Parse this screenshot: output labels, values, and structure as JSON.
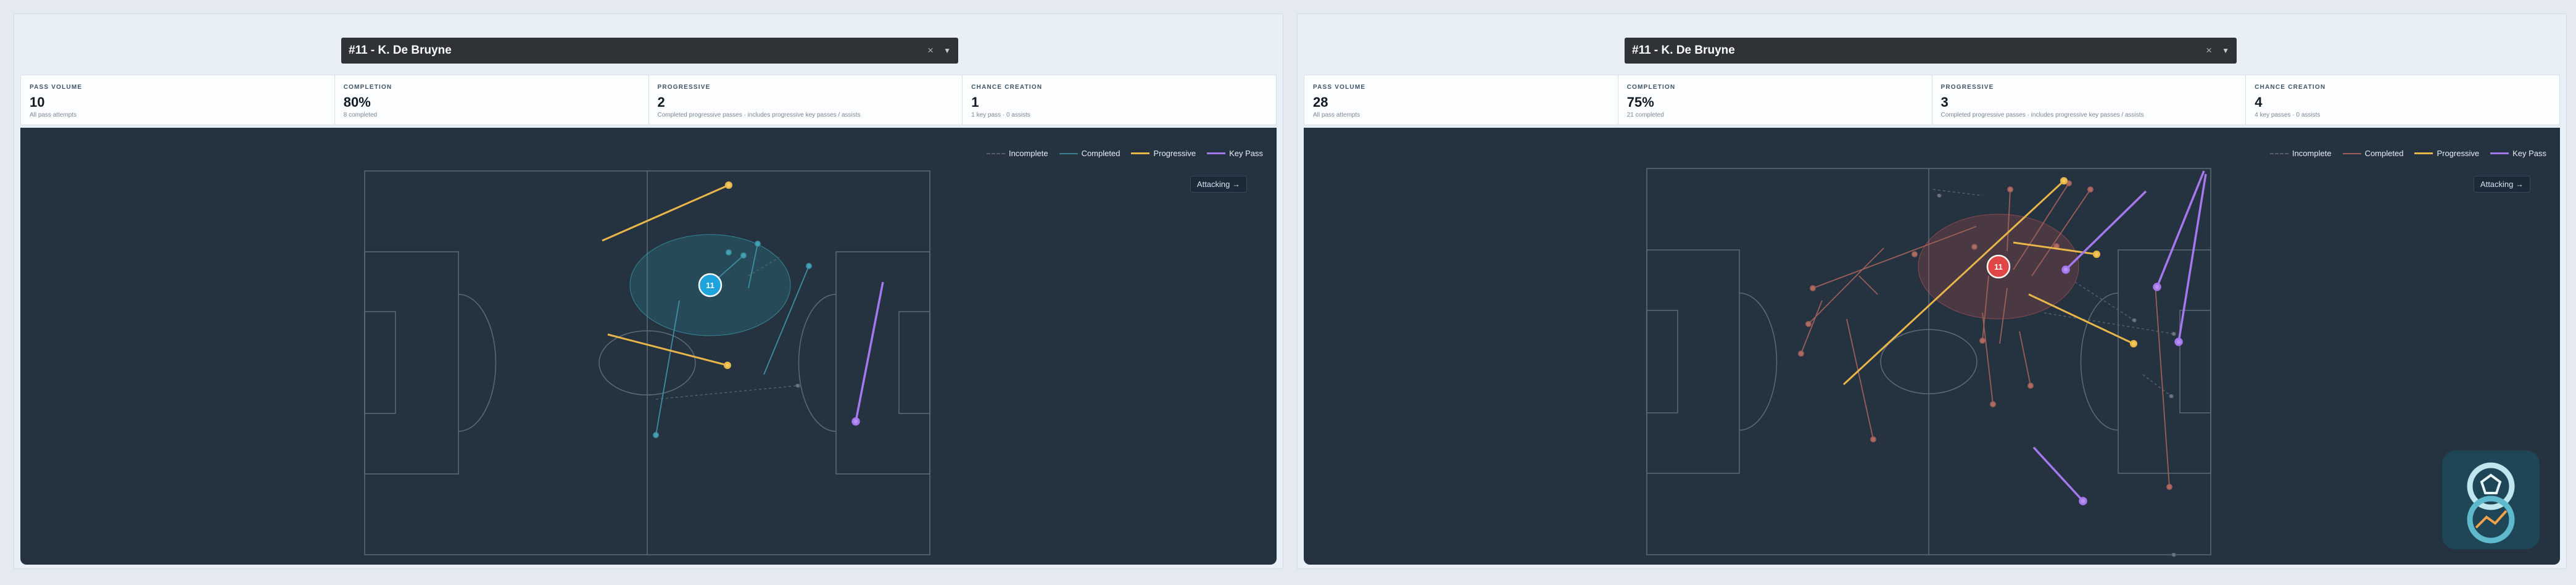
{
  "panels": [
    {
      "player_select": "#11 - K. De Bruyne",
      "clear_glyph": "×",
      "caret_glyph": "▼",
      "stats": [
        {
          "label": "PASS VOLUME",
          "value": "10",
          "sub": "All pass attempts"
        },
        {
          "label": "COMPLETION",
          "value": "80%",
          "sub": "8 completed"
        },
        {
          "label": "PROGRESSIVE",
          "value": "2",
          "sub": "Completed progressive passes · includes progressive key passes / assists"
        },
        {
          "label": "CHANCE CREATION",
          "value": "1",
          "sub": "1 key pass · 0 assists"
        }
      ],
      "legend": {
        "incomplete": "Incomplete",
        "completed": "Completed",
        "progressive": "Progressive",
        "key_pass": "Key Pass"
      },
      "direction_button": "Attacking →",
      "player_marker": "11",
      "accent_color": "#1fa3dc"
    },
    {
      "player_select": "#11 - K. De Bruyne",
      "clear_glyph": "×",
      "caret_glyph": "▼",
      "stats": [
        {
          "label": "PASS VOLUME",
          "value": "28",
          "sub": "All pass attempts"
        },
        {
          "label": "COMPLETION",
          "value": "75%",
          "sub": "21 completed"
        },
        {
          "label": "PROGRESSIVE",
          "value": "3",
          "sub": "Completed progressive passes · includes progressive key passes / assists"
        },
        {
          "label": "CHANCE CREATION",
          "value": "4",
          "sub": "4 key passes · 0 assists"
        }
      ],
      "legend": {
        "incomplete": "Incomplete",
        "completed": "Completed",
        "progressive": "Progressive",
        "key_pass": "Key Pass"
      },
      "direction_button": "Attacking →",
      "player_marker": "11",
      "accent_color": "#e04646"
    }
  ],
  "colors": {
    "pitch": "#253240",
    "progressive": "#e9b64a",
    "key_pass": "#a678ee",
    "completed_left": "#3d8fa0",
    "completed_right": "#9b5e58",
    "incomplete": "#53606c"
  },
  "logo_icon": "club-crest-icon"
}
